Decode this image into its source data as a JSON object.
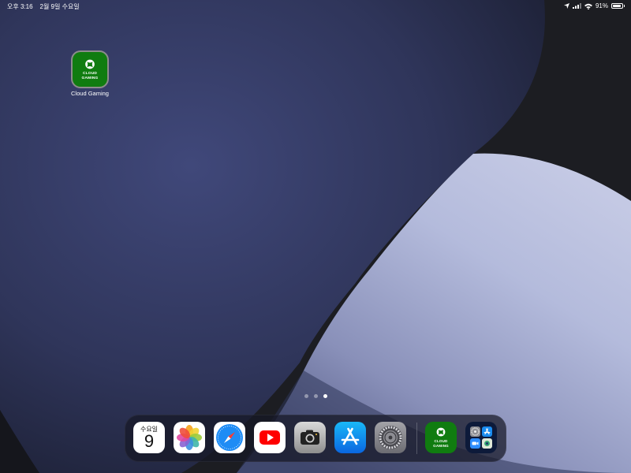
{
  "status_bar": {
    "time": "오후 3:16",
    "date": "2월 9일 수요일",
    "battery_percent": "91%",
    "battery_level": 0.91,
    "icons": [
      "location-arrow-icon",
      "cellular-signal-icon",
      "wifi-icon",
      "battery-icon"
    ]
  },
  "home_screen": {
    "apps": [
      {
        "name": "Cloud Gaming",
        "icon": "xbox-cloud-gaming-icon",
        "icon_text": [
          "CLOUD",
          "GAMING"
        ]
      }
    ],
    "page_indicator": {
      "pages": 3,
      "current": 3
    }
  },
  "dock": {
    "apps": [
      {
        "id": "calendar",
        "icon": "calendar-icon",
        "day": "수요일",
        "date": "9"
      },
      {
        "id": "photos",
        "icon": "photos-icon"
      },
      {
        "id": "safari",
        "icon": "safari-icon"
      },
      {
        "id": "youtube",
        "icon": "youtube-icon"
      },
      {
        "id": "camera",
        "icon": "camera-icon"
      },
      {
        "id": "app-store",
        "icon": "app-store-icon"
      },
      {
        "id": "settings",
        "icon": "settings-gear-icon"
      }
    ],
    "recent_apps": [
      {
        "id": "cloud-gaming",
        "icon": "xbox-cloud-gaming-icon",
        "icon_text": [
          "CLOUD",
          "GAMING"
        ]
      },
      {
        "id": "folder",
        "icon": "app-folder-icon",
        "contents": [
          "settings-gear-icon",
          "app-store-icon",
          "zoom-icon",
          "photo-app-icon"
        ]
      }
    ]
  },
  "colors": {
    "xbox_green": "#107C10",
    "wallpaper_dark": "#1D2031",
    "wallpaper_blue": "#3A416B",
    "wallpaper_light": "#A9B0D4",
    "youtube_red": "#FF0000",
    "safari_blue": "#1E8CF5"
  }
}
